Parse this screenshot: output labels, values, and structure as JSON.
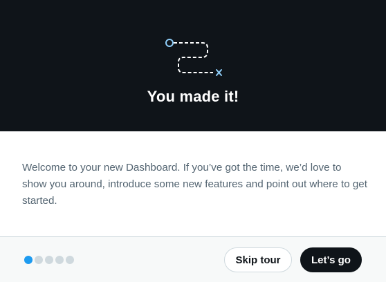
{
  "hero": {
    "title": "You made it!",
    "illustration_icon": "route-path-icon"
  },
  "body": {
    "text": "Welcome to your new Dashboard. If you’ve got the time, we’d love to show you around, introduce some new features and point out where to get started."
  },
  "footer": {
    "steps_total": 5,
    "current_step": 1,
    "skip_label": "Skip tour",
    "go_label": "Let’s go"
  },
  "colors": {
    "hero_bg": "#0f1419",
    "accent": "#1d9bf0",
    "inactive_dot": "#cfd9de",
    "body_text": "#536471"
  }
}
